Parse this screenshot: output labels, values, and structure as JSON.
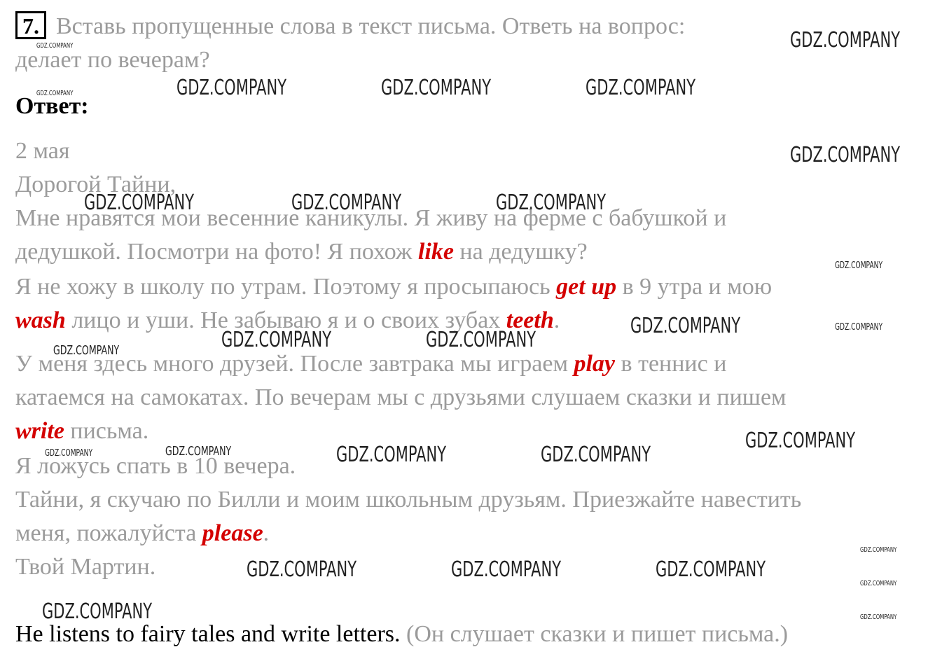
{
  "task": {
    "number": "7.",
    "text_line1": "Вставь пропущенные слова в текст письма. Ответь на вопрос:",
    "text_line2": "делает по вечерам?"
  },
  "answer_title": "Ответ:",
  "letter": {
    "date": "2 мая",
    "greeting": "Дорогой Тайни,",
    "l1": "Мне нравятся мои весенние каникулы. Я живу на ферме с бабушкой и",
    "l2a": "дедушкой. Посмотри на фото! Я похож ",
    "l2_answer": "like",
    "l2b": " на дедушку?",
    "l3a": "Я не хожу в школу по утрам. Поэтому я просыпаюсь ",
    "l3_answer": "get up",
    "l3b": " в 9 утра и мою",
    "l4_answer1": "wash",
    "l4a": " лицо и уши. Не забываю я и о своих зубах ",
    "l4_answer2": "teeth",
    "l4b": ".",
    "l5a": "У меня здесь много друзей. После завтрака мы играем ",
    "l5_answer": "play",
    "l5b": " в теннис и",
    "l6": "катаемся на самокатах. По вечерам мы с друзьями слушаем сказки и пишем",
    "l7_answer": "write",
    "l7b": " письма.",
    "l8": "Я ложусь спать в 10 вечера.",
    "l9": "Тайни, я скучаю по Билли и моим школьным друзьям. Приезжайте навестить",
    "l10a": "меня, пожалуйста ",
    "l10_answer": "please",
    "l10b": ".",
    "signature": "Твой Мартин."
  },
  "final_answer": {
    "english": "He listens to fairy tales and write letters.",
    "russian": " (Он слушает сказки и пишет письма.)"
  },
  "watermark": {
    "text": "GDZ.COMPANY"
  }
}
